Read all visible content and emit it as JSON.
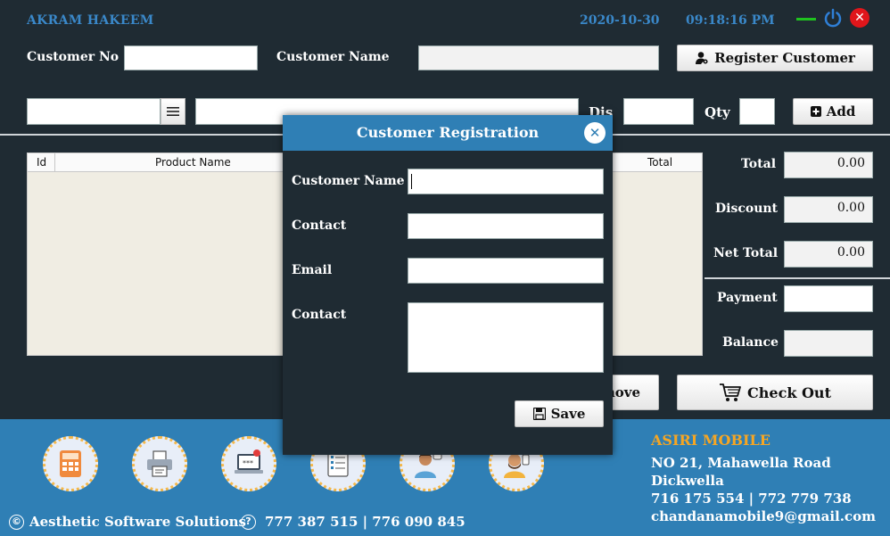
{
  "header": {
    "user_name": "AKRAM HAKEEM",
    "date": "2020-10-30",
    "time": "09:18:16 PM",
    "close_glyph": "✕"
  },
  "customer": {
    "no_label": "Customer No",
    "no_value": "",
    "name_label": "Customer Name",
    "name_value": "",
    "register_button": "Register Customer"
  },
  "item_entry": {
    "code_value": "",
    "product_value": "",
    "dis_label": "Dis",
    "dis_value": "",
    "qty_label": "Qty",
    "qty_value": "",
    "add_button": "Add"
  },
  "grid": {
    "columns": [
      "Id",
      "Product Name",
      "Total"
    ],
    "rows": []
  },
  "summary": {
    "total_label": "Total",
    "total_value": "0.00",
    "discount_label": "Discount",
    "discount_value": "0.00",
    "net_total_label": "Net Total",
    "net_total_value": "0.00",
    "payment_label": "Payment",
    "payment_value": "",
    "balance_label": "Balance",
    "balance_value": ""
  },
  "actions": {
    "remove_button_visible_text": "nove",
    "checkout_button": "Check Out"
  },
  "modal": {
    "title": "Customer Registration",
    "close_glyph": "✕",
    "name_label": "Customer Name",
    "name_value": "",
    "contact_label": "Contact",
    "contact_value": "",
    "email_label": "Email",
    "email_value": "",
    "address_label": "Contact",
    "address_value": "",
    "save_button": "Save"
  },
  "shop": {
    "name": "ASIRI MOBILE",
    "address_line1": "NO 21, Mahawella Road",
    "address_line2": "Dickwella",
    "phones": "716 175 554 | 772 779 738",
    "email": "chandanamobile9@gmail.com"
  },
  "footer": {
    "copyright_glyph": "©",
    "company": "Aesthetic Software Solutions",
    "help_glyph": "?",
    "contact": "777 387 515 | 776 090 845",
    "tiles": [
      "calculator-icon",
      "printer-icon",
      "laptop-password-icon",
      "checklist-icon",
      "support-agent-icon",
      "customer-icon"
    ]
  },
  "colors": {
    "background": "#1f2b33",
    "accent_blue": "#2f7fb5",
    "header_text": "#3a88c9",
    "shop_name": "#f6a623",
    "close_red": "#e0161b",
    "minimize_green": "#1fc21f"
  }
}
